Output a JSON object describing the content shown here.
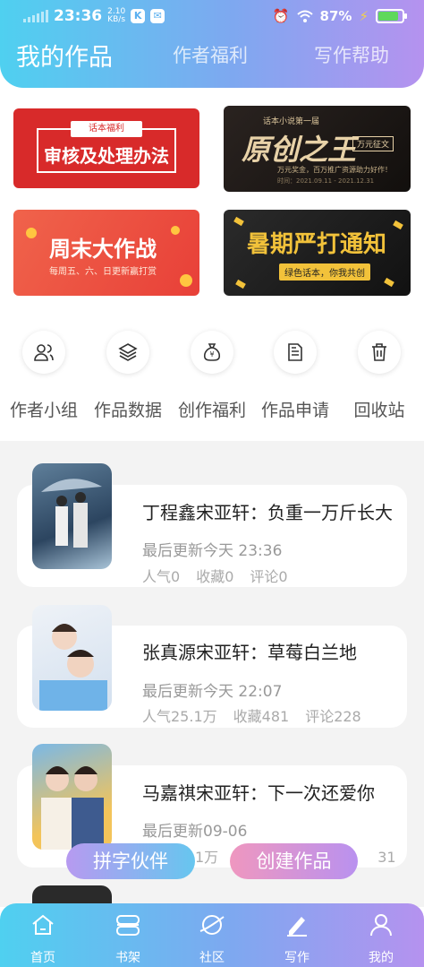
{
  "status_bar": {
    "time": "23:36",
    "speed_value": "2.10",
    "speed_unit": "KB/s",
    "battery": "87%"
  },
  "header": {
    "tabs": [
      {
        "label": "我的作品",
        "active": true
      },
      {
        "label": "作者福利",
        "active": false
      },
      {
        "label": "写作帮助",
        "active": false
      }
    ]
  },
  "banners": {
    "audit": {
      "tag": "话本福利",
      "title": "审核及处理办法"
    },
    "original": {
      "small": "话本小说第一届",
      "title": "原创之王",
      "tag": "万元征文",
      "line1": "万元奖金，百万推广资源助力好作！",
      "line2": "时间：2021.09.11 - 2021.12.31"
    },
    "weekend": {
      "title": "周末大作战",
      "subtitle": "每周五、六、日更新赢打赏"
    },
    "summer": {
      "title": "暑期严打通知",
      "tag": "绿色话本，你我共创"
    }
  },
  "quick_actions": [
    {
      "label": "作者小组",
      "icon": "people-icon"
    },
    {
      "label": "作品数据",
      "icon": "layers-icon"
    },
    {
      "label": "创作福利",
      "icon": "money-bag-icon"
    },
    {
      "label": "作品申请",
      "icon": "document-icon"
    },
    {
      "label": "回收站",
      "icon": "trash-icon"
    }
  ],
  "works": [
    {
      "title": "丁程鑫宋亚轩：负重一万斤长大",
      "updated": "最后更新今天 23:36",
      "popularity": "人气0",
      "favorites": "收藏0",
      "comments": "评论0"
    },
    {
      "title": "张真源宋亚轩：草莓白兰地",
      "updated": "最后更新今天 22:07",
      "popularity": "人气25.1万",
      "favorites": "收藏481",
      "comments": "评论228"
    },
    {
      "title": "马嘉祺宋亚轩：下一次还爱你",
      "updated": "最后更新09-06",
      "popularity": "1万",
      "favorites": "",
      "comments": "31"
    }
  ],
  "floating_buttons": {
    "partner": "拼字伙伴",
    "create": "创建作品"
  },
  "bottom_nav": [
    {
      "label": "首页",
      "icon": "home-icon"
    },
    {
      "label": "书架",
      "icon": "bookshelf-icon"
    },
    {
      "label": "社区",
      "icon": "planet-icon"
    },
    {
      "label": "写作",
      "icon": "pen-icon",
      "active": true
    },
    {
      "label": "我的",
      "icon": "user-icon"
    }
  ],
  "colors": {
    "header_gradient_start": "#4fd0f0",
    "header_gradient_end": "#b592ef",
    "audit_red": "#d82a2a",
    "gold": "#f2c23a"
  }
}
